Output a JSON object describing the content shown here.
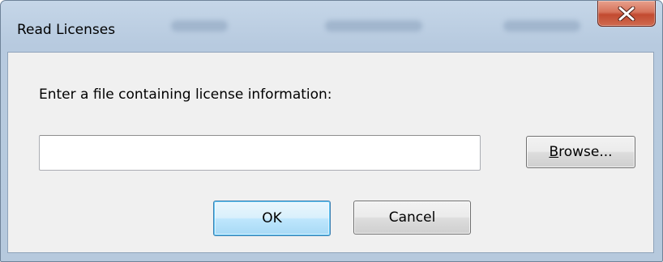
{
  "window": {
    "title": "Read Licenses",
    "close_glyph": "X",
    "close_icon": "close-icon",
    "accent": "#c24a30"
  },
  "dialog": {
    "prompt": "Enter a file containing license information:",
    "file_input": {
      "value": "",
      "placeholder": ""
    },
    "browse_button": {
      "mnemonic": "B",
      "rest": "rowse..."
    },
    "ok_label": "OK",
    "cancel_label": "Cancel"
  }
}
